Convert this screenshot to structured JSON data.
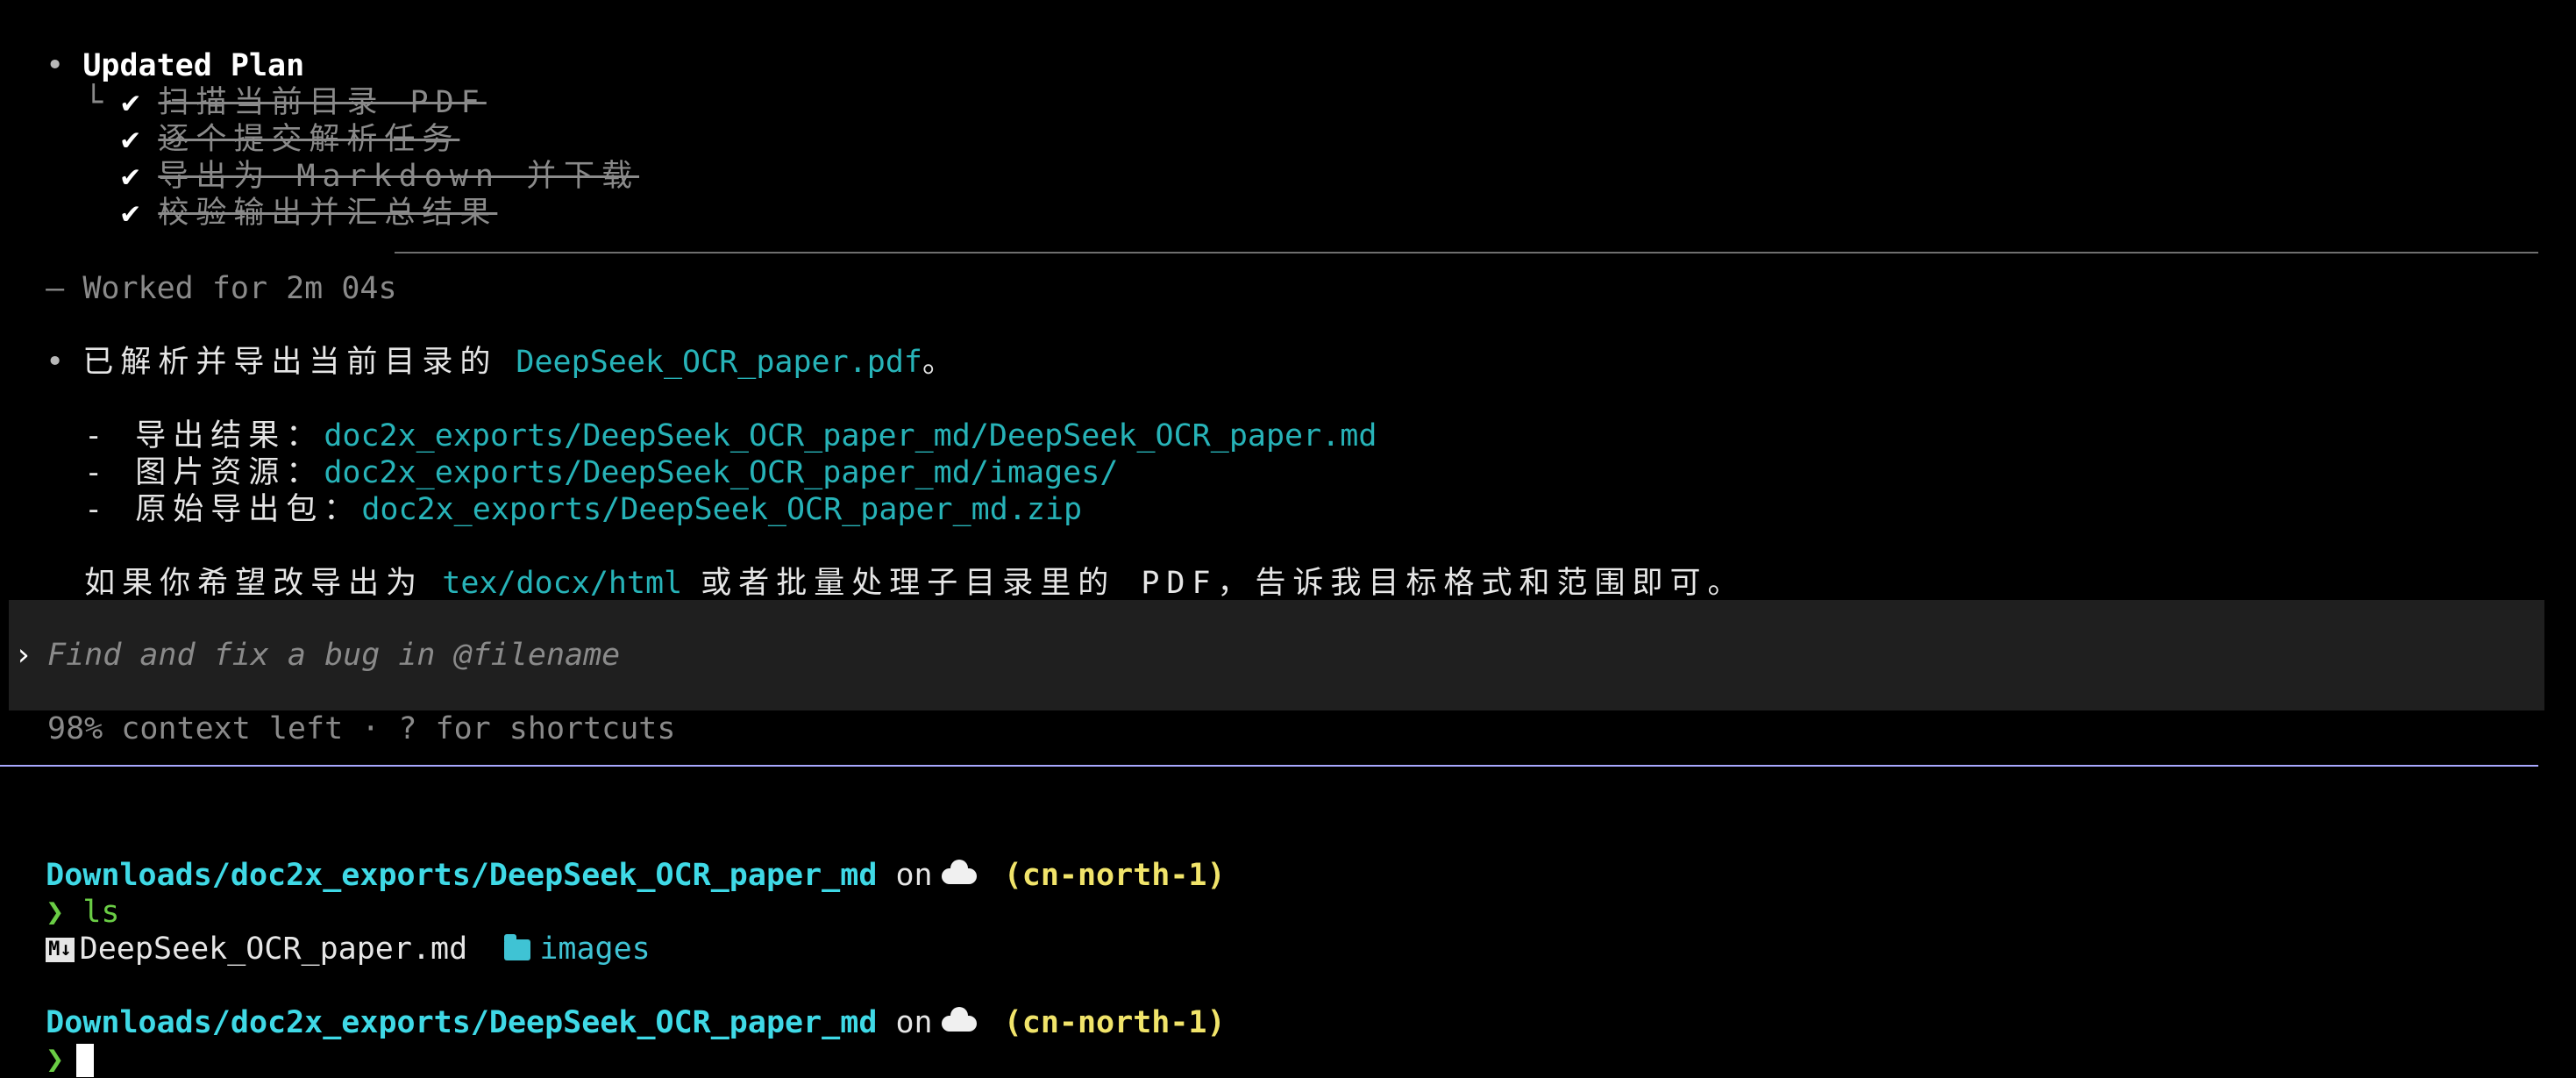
{
  "plan": {
    "bullet": "•",
    "title": "Updated Plan",
    "tree_branch": "└",
    "check_glyph": "✔",
    "items": [
      "扫描当前目录 PDF",
      "逐个提交解析任务",
      "导出为 Markdown 并下载",
      "校验输出并汇总结果"
    ]
  },
  "worked": {
    "dash": "—",
    "label": "Worked for 2m 04s"
  },
  "summary": {
    "bullet": "•",
    "intro": "已解析并导出当前目录的",
    "file": "DeepSeek_OCR_paper.pdf",
    "period": "。",
    "items": [
      {
        "label": "- 导出结果：",
        "value": "doc2x_exports/DeepSeek_OCR_paper_md/DeepSeek_OCR_paper.md"
      },
      {
        "label": "- 图片资源：",
        "value": "doc2x_exports/DeepSeek_OCR_paper_md/images/"
      },
      {
        "label": "- 原始导出包：",
        "value": "doc2x_exports/DeepSeek_OCR_paper_md.zip"
      }
    ],
    "followup_pre": "如果你希望改导出为",
    "followup_formats": "tex/docx/html",
    "followup_post": "或者批量处理子目录里的 PDF，告诉我目标格式和范围即可。"
  },
  "composer": {
    "caret": "›",
    "placeholder": "Find and fix a bug in @filename",
    "status": "98% context left · ? for shortcuts"
  },
  "shell": {
    "path": "Downloads/doc2x_exports/DeepSeek_OCR_paper_md",
    "on": "on",
    "region": "(cn-north-1)",
    "prompt": "❯",
    "command": "ls",
    "md_badge": "M↓",
    "file1": "DeepSeek_OCR_paper.md",
    "file2": "images"
  },
  "colors": {
    "background": "#000000",
    "cyan_link": "#27b3b8",
    "path": "#3fd9e6",
    "region": "#f1e46a",
    "prompt_green": "#6acd45",
    "separator": "#a9a9ff"
  }
}
